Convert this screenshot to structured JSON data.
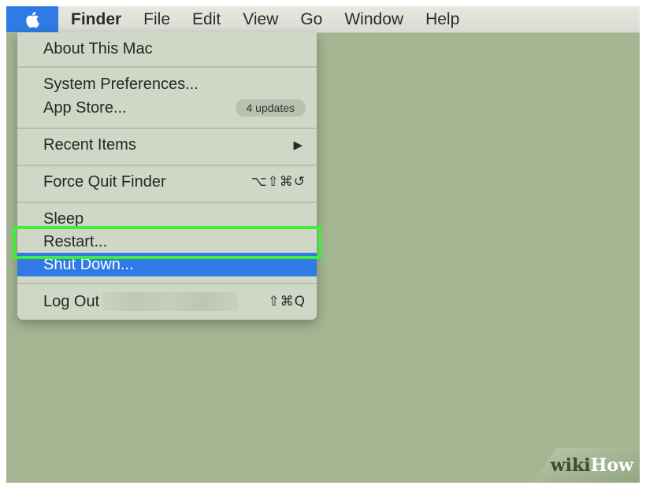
{
  "menubar": {
    "apple_icon": "apple-logo-icon",
    "app_name": "Finder",
    "items": [
      "File",
      "Edit",
      "View",
      "Go",
      "Window",
      "Help"
    ]
  },
  "apple_menu": {
    "about": "About This Mac",
    "system_preferences": "System Preferences...",
    "app_store": "App Store...",
    "app_store_badge": "4 updates",
    "recent_items": "Recent Items",
    "recent_items_arrow": "▶",
    "force_quit": "Force Quit Finder",
    "force_quit_shortcut": "⌥⇧⌘↺",
    "sleep": "Sleep",
    "restart": "Restart...",
    "shut_down": "Shut Down...",
    "log_out": "Log Out",
    "log_out_shortcut": "⇧⌘Q"
  },
  "watermark": {
    "part1": "wiki",
    "part2": "How"
  },
  "colors": {
    "highlight": "#2f7ae4",
    "focus_frame": "#3fee3a",
    "desktop": "#a3b591"
  }
}
